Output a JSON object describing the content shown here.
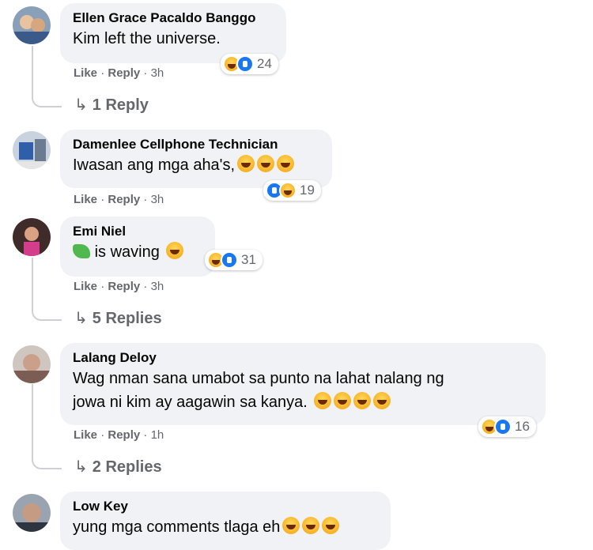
{
  "action_like": "Like",
  "action_reply": "Reply",
  "sep": "·",
  "comments": [
    {
      "name": "Ellen Grace Pacaldo Banggo",
      "text": "Kim left the universe.",
      "time": "3h",
      "count": "24",
      "replies": "1 Reply"
    },
    {
      "name": "Damenlee Cellphone Technician",
      "text": "Iwasan ang mga aha's,",
      "time": "3h",
      "count": "19"
    },
    {
      "name": "Emi Niel",
      "text": "is waving",
      "time": "3h",
      "count": "31",
      "replies": "5 Replies"
    },
    {
      "name": "Lalang Deloy",
      "text_line1": "Wag nman sana umabot sa punto na lahat nalang ng",
      "text_line2": "jowa ni kim ay aagawin sa kanya.",
      "time": "1h",
      "count": "16",
      "replies": "2 Replies"
    },
    {
      "name": "Low Key",
      "text": "yung mga comments tlaga eh"
    }
  ],
  "colors": {
    "bubble": "#f0f2f5",
    "meta": "#65676b",
    "like": "#1877f2",
    "haha": "#f7b125"
  },
  "icons": [
    "haha-reaction-icon",
    "like-reaction-icon",
    "wow-reaction-icon",
    "reply-arrow-icon",
    "waving-hand-icon"
  ]
}
